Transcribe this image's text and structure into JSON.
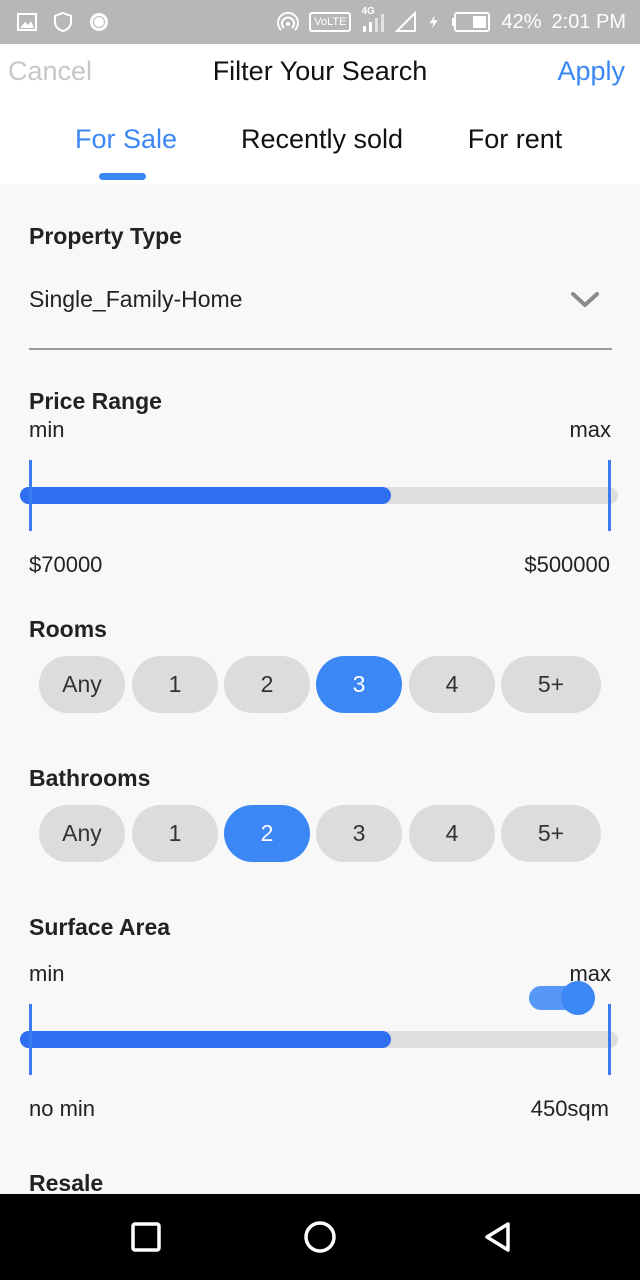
{
  "status_bar": {
    "volte": "VoLTE",
    "network": "4G",
    "battery_percent": "42%",
    "time": "2:01 PM",
    "icons": [
      "image-icon",
      "shield-icon",
      "circle-icon",
      "hotspot-icon",
      "volte-icon",
      "signal-icon",
      "signal-empty-icon",
      "charging-icon",
      "battery-icon"
    ]
  },
  "header": {
    "cancel_label": "Cancel",
    "title": "Filter Your Search",
    "apply_label": "Apply",
    "tabs": [
      {
        "label": "For Sale",
        "active": true
      },
      {
        "label": "Recently sold",
        "active": false
      },
      {
        "label": "For rent",
        "active": false
      }
    ]
  },
  "property_type": {
    "title": "Property Type",
    "value": "Single_Family-Home"
  },
  "price_range": {
    "title": "Price Range",
    "min_label": "min",
    "max_label": "max",
    "min_value": "$70000",
    "max_value": "$500000",
    "fill_fraction": 0.62
  },
  "rooms": {
    "title": "Rooms",
    "options": [
      "Any",
      "1",
      "2",
      "3",
      "4",
      "5+"
    ],
    "selected": "3"
  },
  "bathrooms": {
    "title": "Bathrooms",
    "options": [
      "Any",
      "1",
      "2",
      "3",
      "4",
      "5+"
    ],
    "selected": "2"
  },
  "surface_area": {
    "title": "Surface Area",
    "min_label": "min",
    "max_label": "max",
    "min_value": "no min",
    "max_value": "450sqm",
    "fill_fraction": 0.62
  },
  "resale": {
    "title": "Resale",
    "enabled": true
  },
  "colors": {
    "accent": "#3b87f6",
    "slider_fill": "#2f6ef0",
    "chip_inactive": "#dcdcdc"
  }
}
